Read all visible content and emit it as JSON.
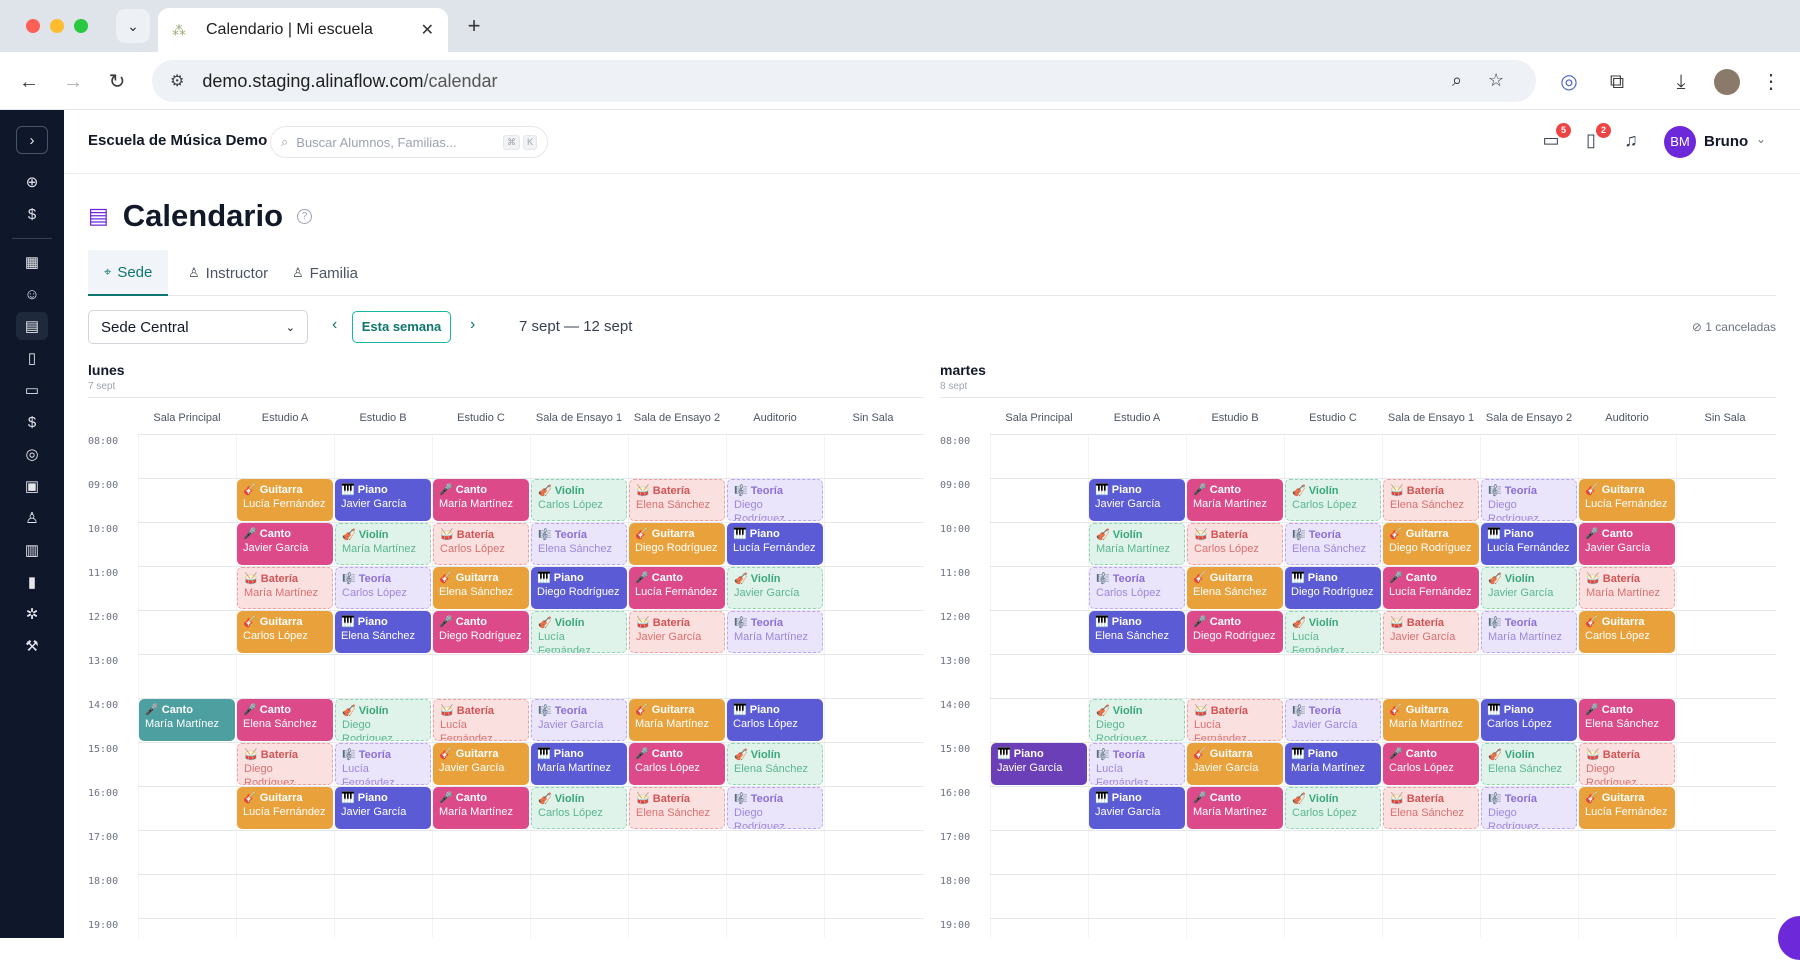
{
  "browser": {
    "tab_title": "Calendario | Mi escuela",
    "url_host": "demo.staging.alinaflow.com",
    "url_path": "/calendar",
    "new_tab": "+",
    "close": "✕"
  },
  "header": {
    "school_name": "Escuela de Música Demo",
    "search_placeholder": "Buscar Alumnos, Familias...",
    "shortcut_keys": [
      "⌘",
      "K"
    ],
    "messages_badge": "5",
    "tasks_badge": "2",
    "user_initials": "BM",
    "user_name": "Bruno"
  },
  "page": {
    "title": "Calendario",
    "tabs": [
      "Sede",
      "Instructor",
      "Familia"
    ],
    "active_tab": "Sede",
    "location_select": "Sede Central",
    "this_week": "Esta semana",
    "date_range": "7 sept — 12 sept",
    "cancelled": "1 canceladas"
  },
  "rooms": [
    "Sala Principal",
    "Estudio A",
    "Estudio B",
    "Estudio C",
    "Sala de Ensayo 1",
    "Sala de Ensayo 2",
    "Auditorio",
    "Sin Sala"
  ],
  "hours": [
    "08:00",
    "09:00",
    "10:00",
    "11:00",
    "12:00",
    "13:00",
    "14:00",
    "15:00",
    "16:00",
    "17:00",
    "18:00",
    "19:00"
  ],
  "instruments": {
    "Guitarra": {
      "icon": "🎸",
      "bg": "#e9a23b",
      "fg": "#ffffff",
      "light": false
    },
    "Piano": {
      "icon": "🎹",
      "bg": "#5b5bd6",
      "fg": "#ffffff",
      "light": false
    },
    "Canto": {
      "icon": "🎤",
      "bg": "#dc4a8a",
      "fg": "#ffffff",
      "light": false
    },
    "Violín": {
      "icon": "🎻",
      "bg": "#dff3ea",
      "fg": "#3aa77a",
      "border": "#8fd3b5",
      "light": true
    },
    "Batería": {
      "icon": "🥁",
      "bg": "#fbe0e0",
      "fg": "#d25454",
      "border": "#ee9f9f",
      "light": true
    },
    "Teoría": {
      "icon": "🎼",
      "bg": "#ebe5fb",
      "fg": "#8b6fd6",
      "border": "#b9a6ee",
      "light": true
    }
  },
  "days": [
    {
      "name": "lunes",
      "date": "7 sept",
      "events": [
        {
          "room": 1,
          "hour": 9,
          "type": "Guitarra",
          "student": "Lucía Fernández"
        },
        {
          "room": 2,
          "hour": 9,
          "type": "Piano",
          "student": "Javier García"
        },
        {
          "room": 3,
          "hour": 9,
          "type": "Canto",
          "student": "María Martínez"
        },
        {
          "room": 4,
          "hour": 9,
          "type": "Violín",
          "student": "Carlos López"
        },
        {
          "room": 5,
          "hour": 9,
          "type": "Batería",
          "student": "Elena Sánchez"
        },
        {
          "room": 6,
          "hour": 9,
          "type": "Teoría",
          "student": "Diego Rodríguez"
        },
        {
          "room": 1,
          "hour": 10,
          "type": "Canto",
          "student": "Javier García"
        },
        {
          "room": 2,
          "hour": 10,
          "type": "Violín",
          "student": "María Martínez"
        },
        {
          "room": 3,
          "hour": 10,
          "type": "Batería",
          "student": "Carlos López"
        },
        {
          "room": 4,
          "hour": 10,
          "type": "Teoría",
          "student": "Elena Sánchez"
        },
        {
          "room": 5,
          "hour": 10,
          "type": "Guitarra",
          "student": "Diego Rodríguez"
        },
        {
          "room": 6,
          "hour": 10,
          "type": "Piano",
          "student": "Lucía Fernández"
        },
        {
          "room": 1,
          "hour": 11,
          "type": "Batería",
          "student": "María Martínez"
        },
        {
          "room": 2,
          "hour": 11,
          "type": "Teoría",
          "student": "Carlos López"
        },
        {
          "room": 3,
          "hour": 11,
          "type": "Guitarra",
          "student": "Elena Sánchez"
        },
        {
          "room": 4,
          "hour": 11,
          "type": "Piano",
          "student": "Diego Rodríguez"
        },
        {
          "room": 5,
          "hour": 11,
          "type": "Canto",
          "student": "Lucía Fernández"
        },
        {
          "room": 6,
          "hour": 11,
          "type": "Violín",
          "student": "Javier García"
        },
        {
          "room": 1,
          "hour": 12,
          "type": "Guitarra",
          "student": "Carlos López"
        },
        {
          "room": 2,
          "hour": 12,
          "type": "Piano",
          "student": "Elena Sánchez"
        },
        {
          "room": 3,
          "hour": 12,
          "type": "Canto",
          "student": "Diego Rodríguez"
        },
        {
          "room": 4,
          "hour": 12,
          "type": "Violín",
          "student": "Lucía Fernández"
        },
        {
          "room": 5,
          "hour": 12,
          "type": "Batería",
          "student": "Javier García"
        },
        {
          "room": 6,
          "hour": 12,
          "type": "Teoría",
          "student": "María Martínez"
        },
        {
          "room": 0,
          "hour": 14,
          "type": "Canto",
          "student": "María Martínez",
          "color": "#4e9fa0"
        },
        {
          "room": 1,
          "hour": 14,
          "type": "Canto",
          "student": "Elena Sánchez"
        },
        {
          "room": 2,
          "hour": 14,
          "type": "Violín",
          "student": "Diego Rodríguez"
        },
        {
          "room": 3,
          "hour": 14,
          "type": "Batería",
          "student": "Lucía Fernández"
        },
        {
          "room": 4,
          "hour": 14,
          "type": "Teoría",
          "student": "Javier García"
        },
        {
          "room": 5,
          "hour": 14,
          "type": "Guitarra",
          "student": "María Martínez"
        },
        {
          "room": 6,
          "hour": 14,
          "type": "Piano",
          "student": "Carlos López"
        },
        {
          "room": 1,
          "hour": 15,
          "type": "Batería",
          "student": "Diego Rodríguez"
        },
        {
          "room": 2,
          "hour": 15,
          "type": "Teoría",
          "student": "Lucía Fernández"
        },
        {
          "room": 3,
          "hour": 15,
          "type": "Guitarra",
          "student": "Javier García"
        },
        {
          "room": 4,
          "hour": 15,
          "type": "Piano",
          "student": "María Martínez"
        },
        {
          "room": 5,
          "hour": 15,
          "type": "Canto",
          "student": "Carlos López"
        },
        {
          "room": 6,
          "hour": 15,
          "type": "Violín",
          "student": "Elena Sánchez"
        },
        {
          "room": 1,
          "hour": 16,
          "type": "Guitarra",
          "student": "Lucía Fernández"
        },
        {
          "room": 2,
          "hour": 16,
          "type": "Piano",
          "student": "Javier García"
        },
        {
          "room": 3,
          "hour": 16,
          "type": "Canto",
          "student": "María Martínez"
        },
        {
          "room": 4,
          "hour": 16,
          "type": "Violín",
          "student": "Carlos López"
        },
        {
          "room": 5,
          "hour": 16,
          "type": "Batería",
          "student": "Elena Sánchez"
        },
        {
          "room": 6,
          "hour": 16,
          "type": "Teoría",
          "student": "Diego Rodríguez"
        }
      ]
    },
    {
      "name": "martes",
      "date": "8 sept",
      "events": [
        {
          "room": 1,
          "hour": 9,
          "type": "Piano",
          "student": "Javier García"
        },
        {
          "room": 2,
          "hour": 9,
          "type": "Canto",
          "student": "María Martínez"
        },
        {
          "room": 3,
          "hour": 9,
          "type": "Violín",
          "student": "Carlos López"
        },
        {
          "room": 4,
          "hour": 9,
          "type": "Batería",
          "student": "Elena Sánchez"
        },
        {
          "room": 5,
          "hour": 9,
          "type": "Teoría",
          "student": "Diego Rodríguez"
        },
        {
          "room": 6,
          "hour": 9,
          "type": "Guitarra",
          "student": "Lucía Fernández"
        },
        {
          "room": 1,
          "hour": 10,
          "type": "Violín",
          "student": "María Martínez"
        },
        {
          "room": 2,
          "hour": 10,
          "type": "Batería",
          "student": "Carlos López"
        },
        {
          "room": 3,
          "hour": 10,
          "type": "Teoría",
          "student": "Elena Sánchez"
        },
        {
          "room": 4,
          "hour": 10,
          "type": "Guitarra",
          "student": "Diego Rodríguez"
        },
        {
          "room": 5,
          "hour": 10,
          "type": "Piano",
          "student": "Lucía Fernández"
        },
        {
          "room": 6,
          "hour": 10,
          "type": "Canto",
          "student": "Javier García"
        },
        {
          "room": 1,
          "hour": 11,
          "type": "Teoría",
          "student": "Carlos López"
        },
        {
          "room": 2,
          "hour": 11,
          "type": "Guitarra",
          "student": "Elena Sánchez"
        },
        {
          "room": 3,
          "hour": 11,
          "type": "Piano",
          "student": "Diego Rodríguez"
        },
        {
          "room": 4,
          "hour": 11,
          "type": "Canto",
          "student": "Lucía Fernández"
        },
        {
          "room": 5,
          "hour": 11,
          "type": "Violín",
          "student": "Javier García"
        },
        {
          "room": 6,
          "hour": 11,
          "type": "Batería",
          "student": "María Martínez"
        },
        {
          "room": 1,
          "hour": 12,
          "type": "Piano",
          "student": "Elena Sánchez"
        },
        {
          "room": 2,
          "hour": 12,
          "type": "Canto",
          "student": "Diego Rodríguez"
        },
        {
          "room": 3,
          "hour": 12,
          "type": "Violín",
          "student": "Lucía Fernández"
        },
        {
          "room": 4,
          "hour": 12,
          "type": "Batería",
          "student": "Javier García"
        },
        {
          "room": 5,
          "hour": 12,
          "type": "Teoría",
          "student": "María Martínez"
        },
        {
          "room": 6,
          "hour": 12,
          "type": "Guitarra",
          "student": "Carlos López"
        },
        {
          "room": 1,
          "hour": 14,
          "type": "Violín",
          "student": "Diego Rodríguez"
        },
        {
          "room": 2,
          "hour": 14,
          "type": "Batería",
          "student": "Lucía Fernández"
        },
        {
          "room": 3,
          "hour": 14,
          "type": "Teoría",
          "student": "Javier García"
        },
        {
          "room": 4,
          "hour": 14,
          "type": "Guitarra",
          "student": "María Martínez"
        },
        {
          "room": 5,
          "hour": 14,
          "type": "Piano",
          "student": "Carlos López"
        },
        {
          "room": 6,
          "hour": 14,
          "type": "Canto",
          "student": "Elena Sánchez"
        },
        {
          "room": 0,
          "hour": 15,
          "type": "Piano",
          "student": "Javier García",
          "color": "#6a3fb8"
        },
        {
          "room": 1,
          "hour": 15,
          "type": "Teoría",
          "student": "Lucía Fernández"
        },
        {
          "room": 2,
          "hour": 15,
          "type": "Guitarra",
          "student": "Javier García"
        },
        {
          "room": 3,
          "hour": 15,
          "type": "Piano",
          "student": "María Martínez"
        },
        {
          "room": 4,
          "hour": 15,
          "type": "Canto",
          "student": "Carlos López"
        },
        {
          "room": 5,
          "hour": 15,
          "type": "Violín",
          "student": "Elena Sánchez"
        },
        {
          "room": 6,
          "hour": 15,
          "type": "Batería",
          "student": "Diego Rodríguez"
        },
        {
          "room": 1,
          "hour": 16,
          "type": "Piano",
          "student": "Javier García"
        },
        {
          "room": 2,
          "hour": 16,
          "type": "Canto",
          "student": "María Martínez"
        },
        {
          "room": 3,
          "hour": 16,
          "type": "Violín",
          "student": "Carlos López"
        },
        {
          "room": 4,
          "hour": 16,
          "type": "Batería",
          "student": "Elena Sánchez"
        },
        {
          "room": 5,
          "hour": 16,
          "type": "Teoría",
          "student": "Diego Rodríguez"
        },
        {
          "room": 6,
          "hour": 16,
          "type": "Guitarra",
          "student": "Lucía Fernández"
        }
      ]
    }
  ]
}
